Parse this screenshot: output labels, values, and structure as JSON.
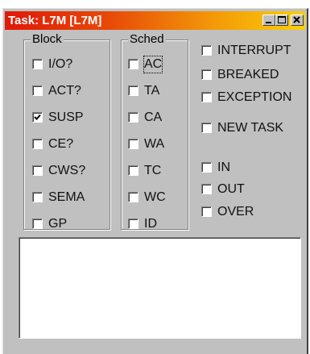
{
  "window": {
    "title": "Task: L7M [L7M]"
  },
  "block": {
    "label": "Block",
    "items": [
      {
        "label": "I/O?",
        "checked": false
      },
      {
        "label": "ACT?",
        "checked": false
      },
      {
        "label": "SUSP",
        "checked": true
      },
      {
        "label": "CE?",
        "checked": false
      },
      {
        "label": "CWS?",
        "checked": false
      },
      {
        "label": "SEMA",
        "checked": false
      },
      {
        "label": "GP",
        "checked": false
      }
    ]
  },
  "sched": {
    "label": "Sched",
    "items": [
      {
        "label": "AC",
        "checked": false
      },
      {
        "label": "TA",
        "checked": false
      },
      {
        "label": "CA",
        "checked": false
      },
      {
        "label": "WA",
        "checked": false
      },
      {
        "label": "TC",
        "checked": false
      },
      {
        "label": "WC",
        "checked": false
      },
      {
        "label": "ID",
        "checked": false
      }
    ]
  },
  "flags": {
    "items": [
      {
        "label": "INTERRUPT",
        "checked": false
      },
      {
        "label": "BREAKED",
        "checked": false
      },
      {
        "label": "EXCEPTION",
        "checked": false
      },
      {
        "label": "NEW TASK",
        "checked": false
      },
      {
        "label": "IN",
        "checked": false
      },
      {
        "label": "OUT",
        "checked": false
      },
      {
        "label": "OVER",
        "checked": false
      }
    ]
  },
  "output": {
    "value": ""
  }
}
